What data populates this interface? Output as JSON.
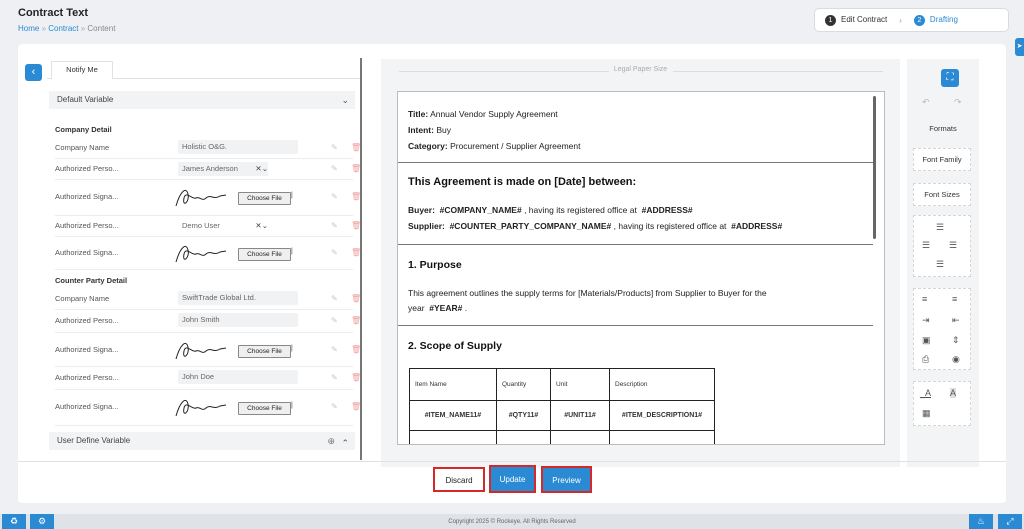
{
  "header": {
    "title": "Contract Text",
    "breadcrumb": [
      "Home",
      "Contract",
      "Content"
    ],
    "steps": [
      {
        "number": "1",
        "label": "Edit Contract"
      },
      {
        "number": "2",
        "label": "Drafting"
      }
    ]
  },
  "left_panel": {
    "tab": "Notify Me",
    "section_default": "Default Variable",
    "group_company": "Company Detail",
    "company_rows": [
      {
        "label": "Company Name",
        "value": "Holistic O&G."
      },
      {
        "label": "Authorized Perso...",
        "value": "James Anderson"
      },
      {
        "label": "Authorized Signa...",
        "value": "Choose File"
      },
      {
        "label": "Authorized Perso...",
        "value": "Demo User"
      },
      {
        "label": "Authorized Signa...",
        "value": "Choose File"
      }
    ],
    "group_counter": "Counter Party Detail",
    "counter_rows": [
      {
        "label": "Company Name",
        "value": "SwiftTrade Global Ltd."
      },
      {
        "label": "Authorized Perso...",
        "value": "John Smith"
      },
      {
        "label": "Authorized Signa...",
        "value": "Choose File"
      },
      {
        "label": "Authorized Perso...",
        "value": "John Doe"
      },
      {
        "label": "Authorized Signa...",
        "value": "Choose File"
      }
    ],
    "section_user": "User Define Variable"
  },
  "document": {
    "paper_label": "Legal Paper Size",
    "title_label": "Title:",
    "title_value": "Annual Vendor Supply Agreement",
    "intent_label": "Intent:",
    "intent_value": "Buy",
    "category_label": "Category:",
    "category_value": "Procurement / Supplier Agreement",
    "heading": "This Agreement is made on [Date] between:",
    "buyer_label": "Buyer:",
    "buyer_var": "#COMPANY_NAME#",
    "buyer_text": ", having its registered office at",
    "buyer_addr": "#ADDRESS#",
    "supplier_label": "Supplier:",
    "supplier_var": "#COUNTER_PARTY_COMPANY_NAME#",
    "supplier_text": ", having its registered office at",
    "supplier_addr": "#ADDRESS#",
    "purpose_heading": "1. Purpose",
    "purpose_text": "This agreement outlines the supply terms for [Materials/Products] from Supplier to Buyer for the",
    "purpose_text2": "year",
    "purpose_var": "#YEAR#",
    "scope_heading": "2. Scope of Supply",
    "table": {
      "headers": [
        "Item Name",
        "Quantity",
        "Unit",
        "Description"
      ],
      "row": [
        "#ITEM_NAME11#",
        "#QTY11#",
        "#UNIT11#",
        "#ITEM_DESCRIPTION1#"
      ]
    }
  },
  "right_toolbar": {
    "formats": "Formats",
    "font_family": "Font Family",
    "font_sizes": "Font Sizes"
  },
  "footer": {
    "discard": "Discard",
    "update": "Update",
    "preview": "Preview",
    "copyright": "Copyright 2025 © Rockeye. All Rights Reserved"
  }
}
